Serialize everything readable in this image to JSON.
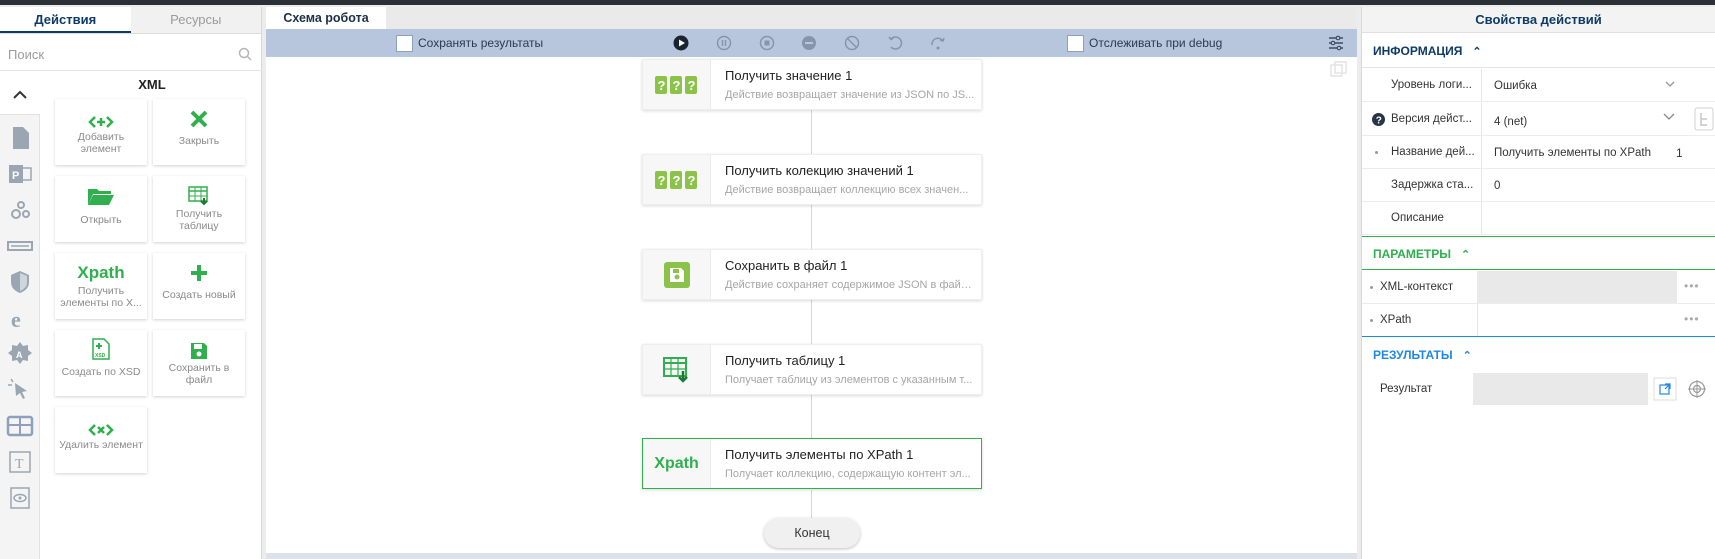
{
  "left": {
    "tabs": [
      "Действия",
      "Ресурсы"
    ],
    "search_placeholder": "Поиск",
    "group_title": "XML",
    "tiles": [
      {
        "label": "Добавить элемент",
        "icon": "add-element-icon"
      },
      {
        "label": "Закрыть",
        "icon": "close-x-icon"
      },
      {
        "label": "Открыть",
        "icon": "folder-open-icon"
      },
      {
        "label": "Получить таблицу",
        "icon": "table-download-icon"
      },
      {
        "label": "Получить элементы по X...",
        "icon": "xpath-text-icon",
        "icon_text": "Xpath"
      },
      {
        "label": "Создать новый",
        "icon": "plus-icon"
      },
      {
        "label": "Создать по XSD",
        "icon": "xsd-file-icon"
      },
      {
        "label": "Сохранить в файл",
        "icon": "floppy-save-icon"
      },
      {
        "label": "Удалить элемент",
        "icon": "delete-element-icon"
      }
    ]
  },
  "center": {
    "tab": "Схема робота",
    "save_results_label": "Сохранять результаты",
    "track_debug_label": "Отслеживать при debug",
    "nodes": [
      {
        "title": "Получить значение  1",
        "desc": "Действие возвращает значение из JSON по JS...",
        "icon": "question-marks-icon"
      },
      {
        "title": "Получить колекцию значений  1",
        "desc": "Действие возвращает коллекцию всех значен...",
        "icon": "question-marks-icon"
      },
      {
        "title": "Сохранить в файл  1",
        "desc": "Действие сохраняет содержимое JSON в файл...",
        "icon": "floppy-save-icon"
      },
      {
        "title": "Получить таблицу  1",
        "desc": "Получает таблицу из элементов с указанным т...",
        "icon": "table-download-icon"
      },
      {
        "title": "Получить элементы по XPath  1",
        "desc": "Получает коллекцию, содержащую контент эл...",
        "icon": "xpath-text-icon",
        "icon_text": "Xpath"
      }
    ],
    "end_label": "Конец"
  },
  "right": {
    "title": "Свойства действий",
    "sections": {
      "info": "ИНФОРМАЦИЯ",
      "params": "ПАРАМЕТРЫ",
      "results": "РЕЗУЛЬТАТЫ"
    },
    "info_rows": {
      "log_level_label": "Уровень логи...",
      "log_level_value": "Ошибка",
      "version_label": "Версия дейст...",
      "version_value": "4 (net)",
      "name_label": "Название дей...",
      "name_value": "Получить элементы по XPath",
      "name_suffix": "1",
      "delay_label": "Задержка ста...",
      "delay_value": "0",
      "desc_label": "Описание",
      "desc_value": ""
    },
    "param_rows": {
      "xml_context_label": "XML-контекст",
      "xpath_label": "XPath"
    },
    "result_rows": {
      "result_label": "Результат"
    }
  },
  "colors": {
    "accent_navy": "#0d3b66",
    "green": "#2faf4d",
    "toolbar": "#b7c6dc",
    "results_blue": "#1e88e5"
  }
}
